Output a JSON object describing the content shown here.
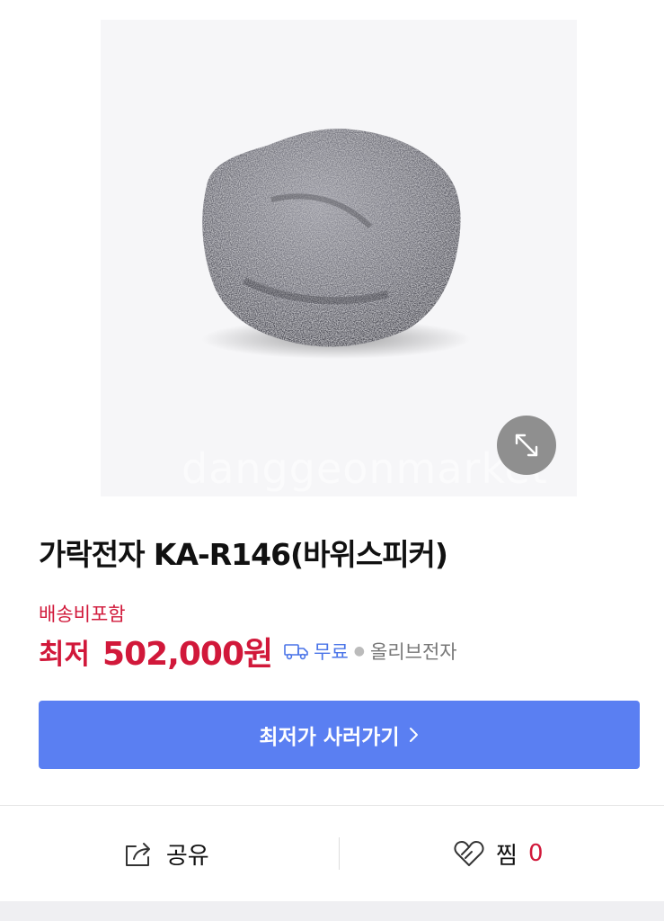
{
  "product": {
    "image_alt": "가락전자 KA-R146(바위스피커)",
    "watermark": "danggeonmarket",
    "title": "가락전자 KA-R146(바위스피커)"
  },
  "pricing": {
    "shipping_note": "배송비포함",
    "prefix": "최저",
    "price": "502,000원",
    "delivery_label": "무료",
    "seller": "올리브전자"
  },
  "buy_button": {
    "label": "최저가 사러가기"
  },
  "actions": {
    "share_label": "공유",
    "wish_label": "찜",
    "wish_count": "0"
  },
  "colors": {
    "accent_red": "#d1183a",
    "button_blue": "#5a7ff2",
    "delivery_blue": "#4a74e8"
  },
  "icons": [
    "expand-icon",
    "truck-icon",
    "chevron-right-icon",
    "share-icon",
    "heart-icon"
  ]
}
